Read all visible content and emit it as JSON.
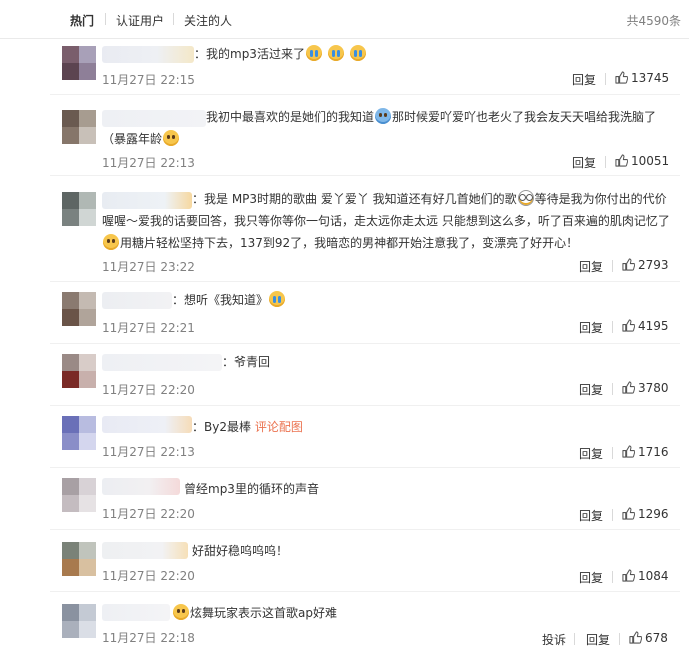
{
  "tabs": [
    {
      "label": "热门",
      "active": true
    },
    {
      "label": "认证用户",
      "active": false
    },
    {
      "label": "关注的人",
      "active": false
    }
  ],
  "total": "共4590条",
  "actions": {
    "reply": "回复",
    "report": "投诉"
  },
  "comments": [
    {
      "text": "：我的mp3活过来了",
      "emojis": [
        "cry-icon",
        "cry-icon",
        "cry-icon"
      ],
      "time": "11月27日 22:15",
      "likes": "13745"
    },
    {
      "text_line1": "我初中最喜欢的是她们的我知道",
      "text_line1b": "那时候爱吖爱吖也老火了我会友天天唱给我洗脑了",
      "text_line2": "（暴露年龄",
      "time": "11月27日 22:13",
      "likes": "10051"
    },
    {
      "text_line1": "：我是 MP3时期的歌曲 爱丫爱丫 我知道还有好几首她们的歌",
      "text_line1b": "等待是我为你付出的代价",
      "text_line2": "喔喔～爱我的话要回答，我只等你等你一句话，走太远你走太远 只能想到这么多，听了百来遍的肌肉记忆了",
      "text_line3": "用糖片轻松坚持下去，137到92了，我暗恋的男神都开始注意我了，变漂亮了好开心！",
      "time": "11月27日 23:22",
      "likes": "2793"
    },
    {
      "text": "：想听《我知道》",
      "time": "11月27日 22:21",
      "likes": "4195"
    },
    {
      "text": "：爷青回",
      "time": "11月27日 22:20",
      "likes": "3780"
    },
    {
      "text": "：By2最棒",
      "link": "评论配图",
      "time": "11月27日 22:13",
      "likes": "1716"
    },
    {
      "text": "曾经mp3里的循环的声音",
      "time": "11月27日 22:20",
      "likes": "1296"
    },
    {
      "text": "好甜好稳呜呜呜！",
      "time": "11月27日 22:20",
      "likes": "1084"
    },
    {
      "text": "炫舞玩家表示这首歌ap好难",
      "time": "11月27日 22:18",
      "likes": "678"
    }
  ]
}
